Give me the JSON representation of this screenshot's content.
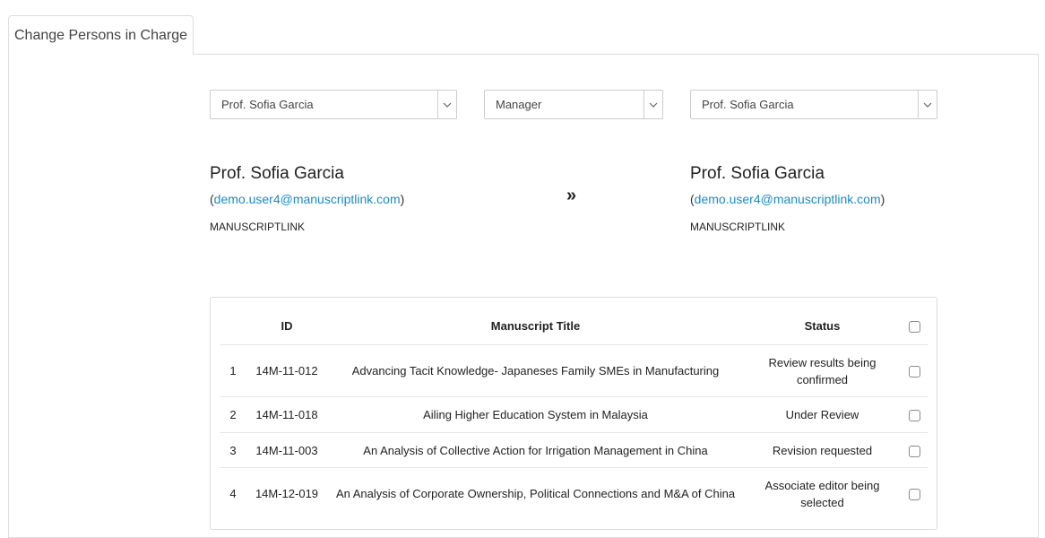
{
  "tab": {
    "label": "Change Persons in Charge"
  },
  "selects": {
    "from_person": "Prof. Sofia Garcia",
    "role": "Manager",
    "to_person": "Prof. Sofia Garcia"
  },
  "from": {
    "name": "Prof. Sofia Garcia",
    "email": "demo.user4@manuscriptlink.com",
    "org": "MANUSCRIPTLINK"
  },
  "to": {
    "name": "Prof. Sofia Garcia",
    "email": "demo.user4@manuscriptlink.com",
    "org": "MANUSCRIPTLINK"
  },
  "arrow_glyph": "»",
  "table": {
    "headers": {
      "id": "ID",
      "title": "Manuscript Title",
      "status": "Status"
    },
    "rows": [
      {
        "num": "1",
        "id": "14M-11-012",
        "title": "Advancing Tacit Knowledge- Japaneses Family SMEs in Manufacturing",
        "status": "Review results being confirmed"
      },
      {
        "num": "2",
        "id": "14M-11-018",
        "title": "Ailing Higher Education System in Malaysia",
        "status": "Under Review"
      },
      {
        "num": "3",
        "id": "14M-11-003",
        "title": "An Analysis of Collective Action for Irrigation Management in China",
        "status": "Revision requested"
      },
      {
        "num": "4",
        "id": "14M-12-019",
        "title": "An Analysis of Corporate Ownership, Political Connections and M&A of China",
        "status": "Associate editor being selected"
      }
    ]
  }
}
